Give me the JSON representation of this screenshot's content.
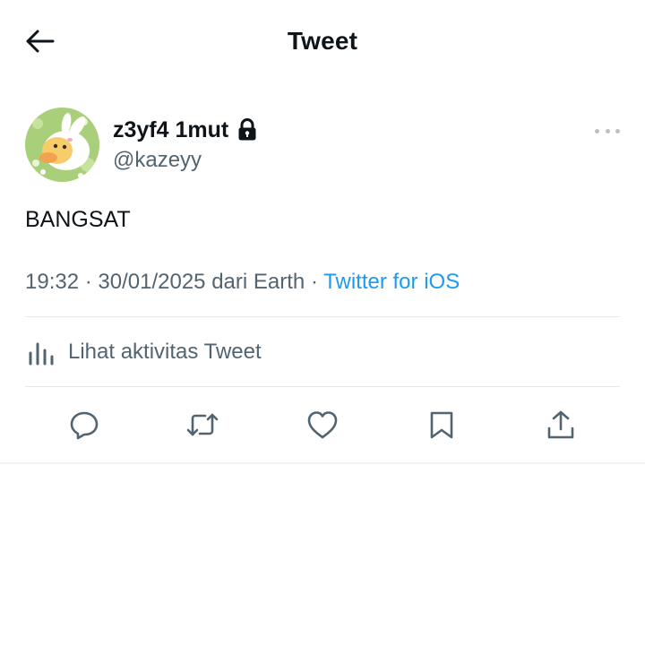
{
  "header": {
    "title": "Tweet",
    "back_icon": "arrow-left-icon"
  },
  "tweet": {
    "author": {
      "display_name": "z3yf4 1mut",
      "handle": "@kazeyy",
      "protected_icon": "lock-icon",
      "avatar_icon": "avatar-duck-image"
    },
    "more_icon": "more-horizontal-icon",
    "text": "BANGSAT",
    "time": "19:32",
    "date": "30/01/2025",
    "location_text": "dari Earth",
    "separator": "·",
    "source": "Twitter for iOS",
    "source_color": "#1d9bf0"
  },
  "activity": {
    "icon": "bar-chart-icon",
    "label": "Lihat aktivitas Tweet"
  },
  "actions": [
    {
      "icon": "reply-icon"
    },
    {
      "icon": "retweet-icon"
    },
    {
      "icon": "like-icon"
    },
    {
      "icon": "bookmark-icon"
    },
    {
      "icon": "share-icon"
    }
  ],
  "colors": {
    "text_primary": "#0f1419",
    "text_secondary": "#536471",
    "divider": "#e6e9eb",
    "accent": "#1d9bf0"
  }
}
